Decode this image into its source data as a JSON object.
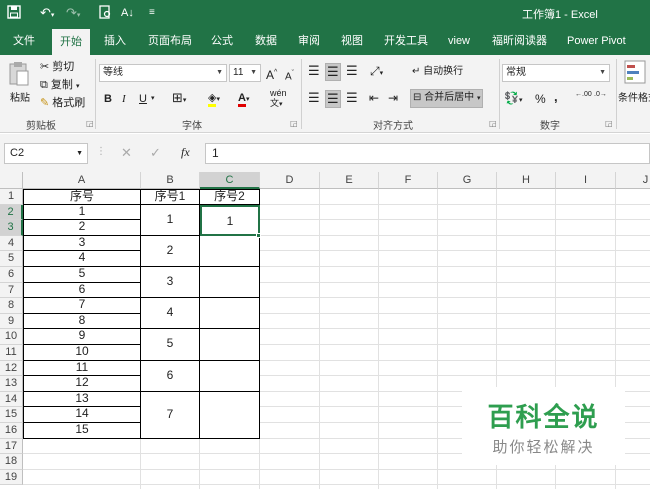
{
  "window": {
    "title": "工作簿1 - Excel"
  },
  "quick_access": {
    "save_icon": "save-icon",
    "undo_icon": "undo-icon",
    "redo_icon": "redo-icon",
    "print_preview_icon": "print-preview-icon",
    "sort_icon": "sort-icon",
    "customize_icon": "customize-icon"
  },
  "ribbon_tabs": [
    {
      "label": "文件"
    },
    {
      "label": "开始"
    },
    {
      "label": "插入"
    },
    {
      "label": "页面布局"
    },
    {
      "label": "公式"
    },
    {
      "label": "数据"
    },
    {
      "label": "审阅"
    },
    {
      "label": "视图"
    },
    {
      "label": "开发工具"
    },
    {
      "label": "view"
    },
    {
      "label": "福昕阅读器"
    },
    {
      "label": "Power Pivot"
    }
  ],
  "ribbon": {
    "clipboard": {
      "paste": "粘贴",
      "cut": "剪切",
      "copy": "复制",
      "format_painter": "格式刷",
      "group": "剪贴板"
    },
    "font": {
      "name": "等线",
      "size": "11",
      "grow": "A",
      "shrink": "A",
      "bold": "B",
      "italic": "I",
      "underline": "U",
      "phonetic": "wén",
      "group": "字体"
    },
    "alignment": {
      "wrap": "自动换行",
      "merge": "合并后居中",
      "group": "对齐方式"
    },
    "number": {
      "format": "常规",
      "percent": "%",
      "comma": ",",
      "inc_decimal": ".00",
      "dec_decimal": ".0",
      "group": "数字"
    },
    "styles": {
      "conditional": "条件格式"
    }
  },
  "formula_bar": {
    "name_box": "C2",
    "fx": "fx",
    "value": "1"
  },
  "columns": [
    "A",
    "B",
    "C",
    "D",
    "E",
    "F",
    "G",
    "H",
    "I",
    "J"
  ],
  "rows": [
    "1",
    "2",
    "3",
    "4",
    "5",
    "6",
    "7",
    "8",
    "9",
    "10",
    "11",
    "12",
    "13",
    "14",
    "15",
    "16",
    "17",
    "18",
    "19"
  ],
  "table": {
    "headers": [
      "序号",
      "序号1",
      "序号2"
    ],
    "col_a": [
      "1",
      "2",
      "3",
      "4",
      "5",
      "6",
      "7",
      "8",
      "9",
      "10",
      "11",
      "12",
      "13",
      "14",
      "15"
    ],
    "col_b": [
      "1",
      "2",
      "3",
      "4",
      "5",
      "6",
      "7"
    ],
    "col_c": [
      "1",
      "",
      "",
      "",
      "",
      "",
      ""
    ]
  },
  "selection": {
    "active_cell": "C2",
    "active_column": "C",
    "active_rows": [
      "2",
      "3"
    ]
  },
  "watermark": {
    "title": "百科全说",
    "subtitle": "助你轻松解决"
  },
  "colors": {
    "accent": "#217346",
    "watermark": "#2e9e4f"
  }
}
